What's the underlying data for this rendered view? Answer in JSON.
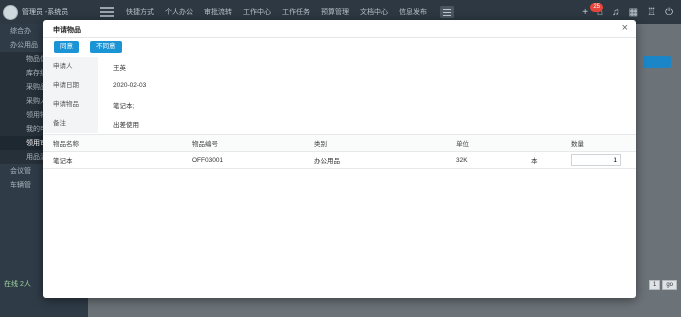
{
  "app": {
    "user_label": "管理员 -系统员",
    "nav": [
      "快捷方式",
      "个人办公",
      "审批流转",
      "工作中心",
      "工作任务",
      "预算管理",
      "文档中心",
      "信息发布"
    ],
    "notification_count": "25"
  },
  "sidebar": {
    "items": [
      {
        "label": "综合办"
      },
      {
        "label": "办公用品"
      },
      {
        "label": "物品信"
      },
      {
        "label": "库存统"
      },
      {
        "label": "采购品"
      },
      {
        "label": "采购人"
      },
      {
        "label": "领用物"
      },
      {
        "label": "我的申"
      },
      {
        "label": "领用审"
      },
      {
        "label": "用品清"
      },
      {
        "label": "会议管"
      },
      {
        "label": "车辆管"
      }
    ],
    "online_status": "在线 2人"
  },
  "background": {
    "pager_page": "1",
    "pager_go": "go"
  },
  "modal": {
    "title": "申请物品",
    "close_glyph": "×",
    "agree_label": "同意",
    "disagree_label": "不同意",
    "fields": [
      {
        "label": "申请人",
        "value": "王英"
      },
      {
        "label": "申请日期",
        "value": "2020-02-03"
      },
      {
        "label": "申请物品",
        "value": "笔记本;"
      },
      {
        "label": "备注",
        "value": "出差使用"
      }
    ],
    "table": {
      "headers": [
        "物品名称",
        "物品编号",
        "类别",
        "单位",
        "",
        "数量"
      ],
      "rows": [
        {
          "name": "笔记本",
          "code": "OFF03001",
          "category": "办公用品",
          "spec": "32K",
          "unit": "本",
          "qty": "1"
        }
      ]
    }
  }
}
